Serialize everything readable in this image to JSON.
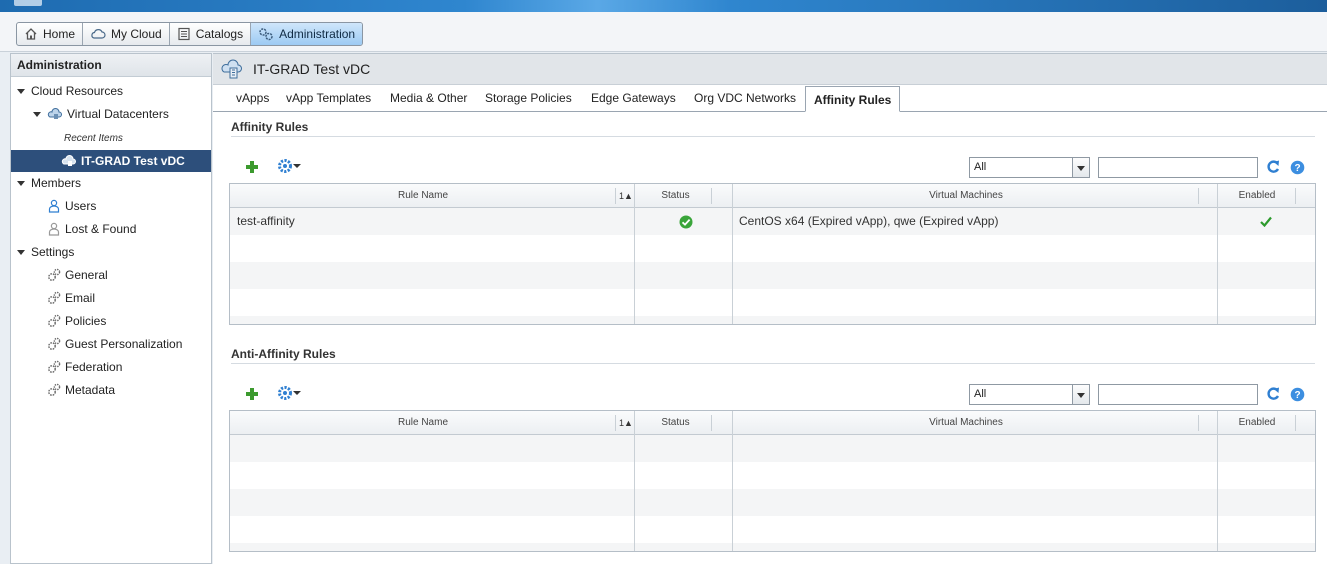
{
  "nav": {
    "home": "Home",
    "mycloud": "My Cloud",
    "catalogs": "Catalogs",
    "administration": "Administration"
  },
  "sidebar": {
    "title": "Administration",
    "cloud_resources": "Cloud Resources",
    "virtual_datacenters": "Virtual Datacenters",
    "recent_items": "Recent Items",
    "vdc": "IT-GRAD Test vDC",
    "members": "Members",
    "users": "Users",
    "lost_found": "Lost & Found",
    "settings": "Settings",
    "general": "General",
    "email": "Email",
    "policies": "Policies",
    "guest_personalization": "Guest Personalization",
    "federation": "Federation",
    "metadata": "Metadata"
  },
  "main": {
    "title": "IT-GRAD Test vDC",
    "tabs": [
      "vApps",
      "vApp Templates",
      "Media & Other",
      "Storage Policies",
      "Edge Gateways",
      "Org VDC Networks",
      "Affinity Rules"
    ]
  },
  "affinity": {
    "title": "Affinity Rules",
    "filter": "All",
    "columns": {
      "rule_name": "Rule Name",
      "sort": "1▲",
      "status": "Status",
      "vms": "Virtual Machines",
      "enabled": "Enabled"
    },
    "rows": [
      {
        "rule_name": "test-affinity",
        "status": "ok",
        "vms": "CentOS x64 (Expired vApp), qwe (Expired vApp)",
        "enabled": true
      }
    ]
  },
  "anti_affinity": {
    "title": "Anti-Affinity Rules",
    "filter": "All",
    "columns": {
      "rule_name": "Rule Name",
      "sort": "1▲",
      "status": "Status",
      "vms": "Virtual Machines",
      "enabled": "Enabled"
    },
    "rows": []
  },
  "icons": {
    "add": "plus-icon",
    "actions": "gear-icon",
    "refresh": "refresh-icon",
    "help": "help-icon",
    "status_ok": "check-circle-icon",
    "enabled": "checkmark-icon"
  },
  "colors": {
    "selected_tree": "#2d4f7b",
    "add_green": "#3c9a2e",
    "gear_blue": "#2f7fd1"
  }
}
